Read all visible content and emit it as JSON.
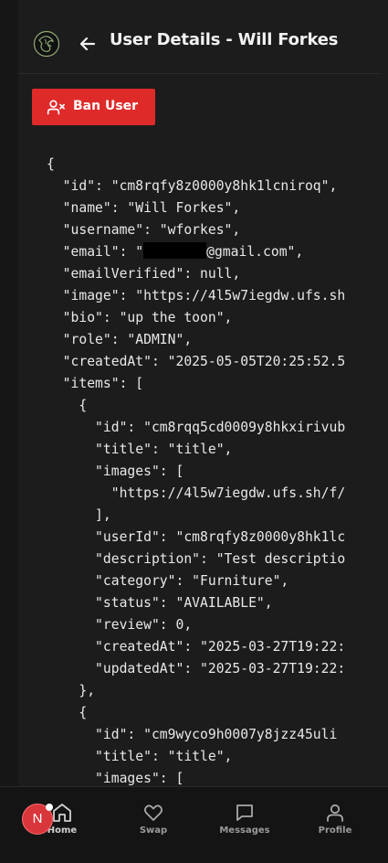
{
  "header": {
    "title": "User Details - Will Forkes"
  },
  "actions": {
    "ban_label": "Ban User"
  },
  "json_view": {
    "lines": [
      "{",
      "  \"id\": \"cm8rqfy8z0000y8hk1lcniroq\",",
      "  \"name\": \"Will Forkes\",",
      "  \"username\": \"wforkes\",",
      "  \"email\": \"",
      "  \"emailVerified\": null,",
      "  \"image\": \"https://4l5w7iegdw.ufs.sh",
      "  \"bio\": \"up the toon\",",
      "  \"role\": \"ADMIN\",",
      "  \"createdAt\": \"2025-05-05T20:25:52.5",
      "  \"items\": [",
      "    {",
      "      \"id\": \"cm8rqq5cd0009y8hkxirivub",
      "      \"title\": \"title\",",
      "      \"images\": [",
      "        \"https://4l5w7iegdw.ufs.sh/f/",
      "      ],",
      "      \"userId\": \"cm8rqfy8z0000y8hk1lc",
      "      \"description\": \"Test descriptio",
      "      \"category\": \"Furniture\",",
      "      \"status\": \"AVAILABLE\",",
      "      \"review\": 0,",
      "      \"createdAt\": \"2025-03-27T19:22:",
      "      \"updatedAt\": \"2025-03-27T19:22:",
      "    },",
      "    {",
      "      \"id\": \"cm9wyco9h0007y8jzz45uli",
      "      \"title\": \"title\",",
      "      \"images\": ["
    ],
    "email_suffix": "@gmail.com\","
  },
  "nav": {
    "home": "Home",
    "swap": "Swap",
    "messages": "Messages",
    "profile": "Profile",
    "avatar_initial": "N"
  },
  "colors": {
    "background": "#1c1c1c",
    "accent_red": "#df2a2a",
    "text": "#e8e8e8"
  },
  "icons": [
    "globe-hand-logo-icon",
    "arrow-left-icon",
    "user-x-icon",
    "home-icon",
    "heart-icon",
    "message-square-icon",
    "user-icon"
  ]
}
